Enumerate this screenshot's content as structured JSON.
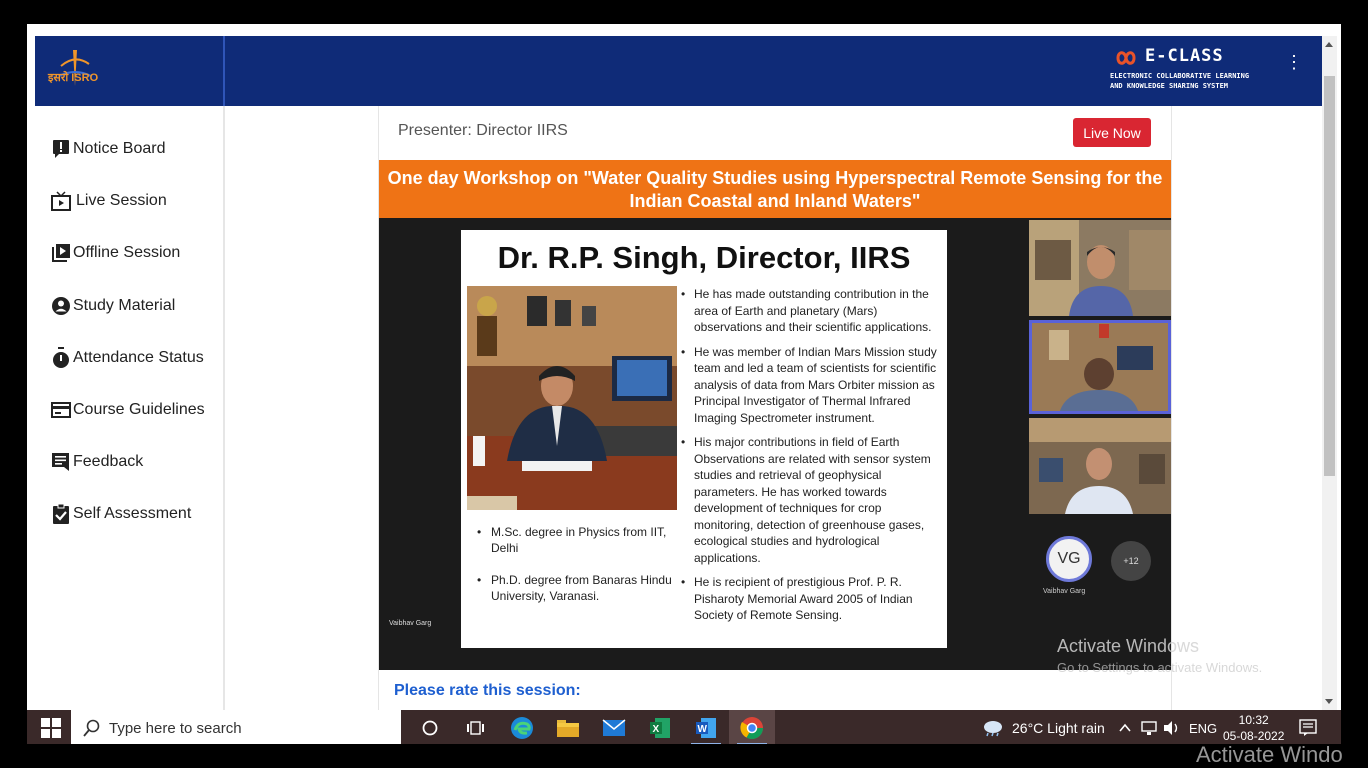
{
  "header": {
    "org_logo_text": "इसरो ISRO",
    "brand_title": "E-CLASS",
    "brand_subtitle_line1": "ELECTRONIC COLLABORATIVE LEARNING",
    "brand_subtitle_line2": "AND KNOWLEDGE SHARING SYSTEM"
  },
  "sidebar": {
    "items": [
      {
        "label": "Notice Board",
        "icon": "notice-icon"
      },
      {
        "label": "Live Session",
        "icon": "tv-icon"
      },
      {
        "label": "Offline Session",
        "icon": "video-library-icon"
      },
      {
        "label": "Study Material",
        "icon": "user-circle-icon"
      },
      {
        "label": "Attendance Status",
        "icon": "stopwatch-icon"
      },
      {
        "label": "Course Guidelines",
        "icon": "card-icon"
      },
      {
        "label": "Feedback",
        "icon": "feedback-icon"
      },
      {
        "label": "Self Assessment",
        "icon": "clipboard-check-icon"
      }
    ]
  },
  "session": {
    "presenter": "Presenter: Director IIRS",
    "live_label": "Live Now",
    "banner_line1": "One day Workshop on \"Water Quality Studies using Hyperspectral Remote Sensing for the",
    "banner_line2": "Indian Coastal and Inland Waters\"",
    "rate_prompt": "Please rate this session:"
  },
  "slide": {
    "title": "Dr. R.P. Singh, Director, IIRS",
    "left_bullets": [
      "M.Sc. degree in Physics from IIT, Delhi",
      "Ph.D. degree from Banaras Hindu University, Varanasi."
    ],
    "right_bullets": [
      "He has made outstanding contribution in the area of Earth and planetary (Mars) observations and their scientific applications.",
      "He was member of Indian Mars Mission study team and led a team of scientists for scientific analysis of data from Mars Orbiter mission as Principal Investigator of Thermal Infrared Imaging Spectrometer instrument.",
      "His major contributions in field of Earth Observations are related with sensor system studies and retrieval of geophysical parameters. He has worked towards development of techniques for crop monitoring, detection of greenhouse gases, ecological studies and hydrological applications.",
      "He is recipient of prestigious Prof. P. R. Pisharoty Memorial Award 2005 of Indian Society of Remote Sensing."
    ],
    "speaker_name": "Vaibhav Garg"
  },
  "participants": {
    "avatar_initials": "VG",
    "avatar_name": "Vaibhav Garg",
    "more_count": "+12"
  },
  "taskbar": {
    "search_placeholder": "Type here to search",
    "weather": "26°C  Light rain",
    "language": "ENG",
    "time": "10:32",
    "date": "05-08-2022"
  },
  "watermark": {
    "title": "Activate Windows",
    "subtitle": "Go to Settings to activate Windows.",
    "overflow": "Activate Windo"
  },
  "colors": {
    "header_bg": "#0f2b78",
    "banner_bg": "#ef7315",
    "live_btn": "#d92632",
    "rate_text": "#1e5fd0",
    "taskbar_bg": "#3a2929"
  }
}
